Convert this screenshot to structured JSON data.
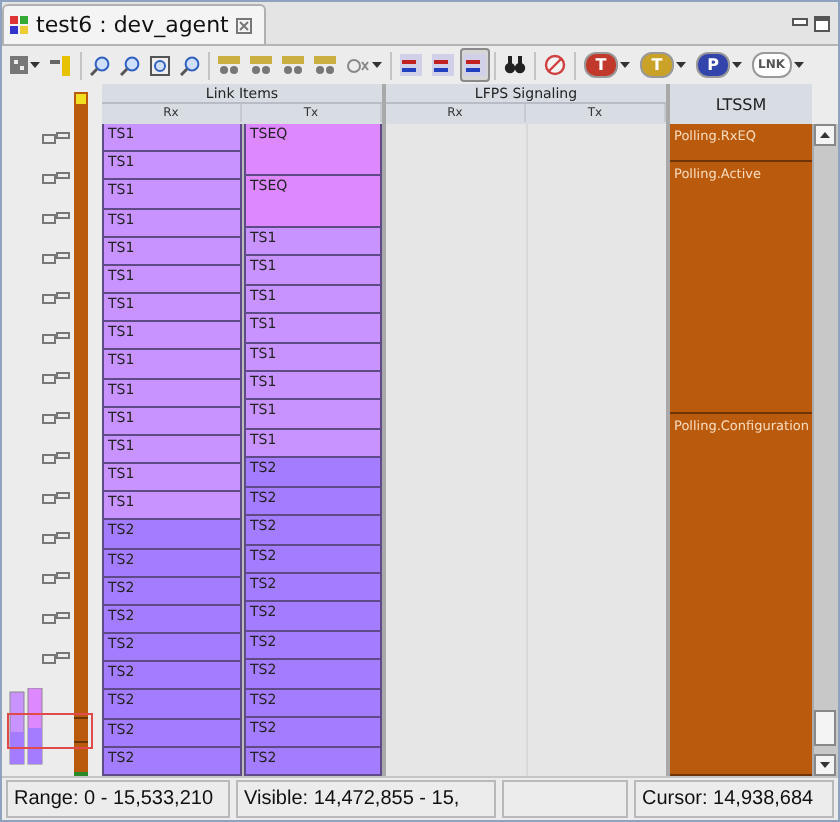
{
  "window": {
    "title": "test6 : dev_agent"
  },
  "toolbar": [
    {
      "kind": "grid",
      "dropdown": true,
      "selected": false
    },
    {
      "kind": "marker",
      "dropdown": false,
      "selected": false
    },
    {
      "kind": "zoom-in",
      "dropdown": false,
      "selected": false
    },
    {
      "kind": "zoom-out",
      "dropdown": false,
      "selected": false
    },
    {
      "kind": "zoom-fit",
      "dropdown": false,
      "selected": false
    },
    {
      "kind": "zoom-person",
      "dropdown": false,
      "selected": false
    },
    {
      "kind": "group",
      "dropdown": false,
      "selected": false
    },
    {
      "kind": "group",
      "dropdown": false,
      "selected": false
    },
    {
      "kind": "group",
      "dropdown": false,
      "selected": false
    },
    {
      "kind": "group",
      "dropdown": false,
      "selected": false
    },
    {
      "kind": "filter",
      "dropdown": true,
      "selected": false
    },
    {
      "kind": "flag",
      "dropdown": false,
      "selected": false
    },
    {
      "kind": "flag",
      "dropdown": false,
      "selected": false
    },
    {
      "kind": "flag",
      "dropdown": false,
      "selected": true
    },
    {
      "kind": "binoculars",
      "dropdown": false,
      "selected": false
    },
    {
      "kind": "cancel",
      "dropdown": false,
      "selected": false
    },
    {
      "kind": "letter",
      "label": "T",
      "color": "#c0392b",
      "dropdown": true,
      "selected": false
    },
    {
      "kind": "letter",
      "label": "T",
      "color": "#c9a227",
      "dropdown": true,
      "selected": false
    },
    {
      "kind": "letter",
      "label": "P",
      "color": "#3344aa",
      "dropdown": true,
      "selected": false
    },
    {
      "kind": "letter",
      "label": "LNK",
      "color": "#ffffff",
      "dropdown": true,
      "selected": false
    }
  ],
  "table": {
    "groups": [
      {
        "title": "Link Items",
        "columns": [
          "Rx",
          "Tx"
        ]
      },
      {
        "title": "LFPS Signaling",
        "columns": [
          "Rx",
          "Tx"
        ]
      }
    ],
    "state_column": "LTSSM",
    "link_rx": [
      {
        "text": "TS1",
        "color": "#c892ff",
        "kind": "short"
      },
      {
        "text": "TS1",
        "color": "#c892ff",
        "kind": "short"
      },
      {
        "text": "TS1",
        "color": "#c892ff",
        "kind": "short"
      },
      {
        "text": "TS1",
        "color": "#c892ff",
        "kind": "short"
      },
      {
        "text": "TS1",
        "color": "#c892ff",
        "kind": "short"
      },
      {
        "text": "TS1",
        "color": "#c892ff",
        "kind": "short"
      },
      {
        "text": "TS1",
        "color": "#c892ff",
        "kind": "short"
      },
      {
        "text": "TS1",
        "color": "#c892ff",
        "kind": "short"
      },
      {
        "text": "TS1",
        "color": "#c892ff",
        "kind": "short"
      },
      {
        "text": "TS1",
        "color": "#c892ff",
        "kind": "short"
      },
      {
        "text": "TS1",
        "color": "#c892ff",
        "kind": "short"
      },
      {
        "text": "TS1",
        "color": "#c892ff",
        "kind": "short"
      },
      {
        "text": "TS1",
        "color": "#c892ff",
        "kind": "short"
      },
      {
        "text": "TS1",
        "color": "#c892ff",
        "kind": "short"
      },
      {
        "text": "TS2",
        "color": "#a47cff",
        "kind": "short"
      },
      {
        "text": "TS2",
        "color": "#a47cff",
        "kind": "short"
      },
      {
        "text": "TS2",
        "color": "#a47cff",
        "kind": "short"
      },
      {
        "text": "TS2",
        "color": "#a47cff",
        "kind": "short"
      },
      {
        "text": "TS2",
        "color": "#a47cff",
        "kind": "short"
      },
      {
        "text": "TS2",
        "color": "#a47cff",
        "kind": "short"
      },
      {
        "text": "TS2",
        "color": "#a47cff",
        "kind": "short"
      },
      {
        "text": "TS2",
        "color": "#a47cff",
        "kind": "short"
      },
      {
        "text": "TS2",
        "color": "#a47cff",
        "kind": "short"
      }
    ],
    "link_tx": [
      {
        "text": "TSEQ",
        "color": "#dd88ff",
        "kind": "long"
      },
      {
        "text": "TSEQ",
        "color": "#dd88ff",
        "kind": "long"
      },
      {
        "text": "TS1",
        "color": "#c892ff",
        "kind": "short"
      },
      {
        "text": "TS1",
        "color": "#c892ff",
        "kind": "short"
      },
      {
        "text": "TS1",
        "color": "#c892ff",
        "kind": "short"
      },
      {
        "text": "TS1",
        "color": "#c892ff",
        "kind": "short"
      },
      {
        "text": "TS1",
        "color": "#c892ff",
        "kind": "short"
      },
      {
        "text": "TS1",
        "color": "#c892ff",
        "kind": "short"
      },
      {
        "text": "TS1",
        "color": "#c892ff",
        "kind": "short"
      },
      {
        "text": "TS1",
        "color": "#c892ff",
        "kind": "short"
      },
      {
        "text": "TS2",
        "color": "#a47cff",
        "kind": "short"
      },
      {
        "text": "TS2",
        "color": "#a47cff",
        "kind": "short"
      },
      {
        "text": "TS2",
        "color": "#a47cff",
        "kind": "short"
      },
      {
        "text": "TS2",
        "color": "#a47cff",
        "kind": "short"
      },
      {
        "text": "TS2",
        "color": "#a47cff",
        "kind": "short"
      },
      {
        "text": "TS2",
        "color": "#a47cff",
        "kind": "short"
      },
      {
        "text": "TS2",
        "color": "#a47cff",
        "kind": "short"
      },
      {
        "text": "TS2",
        "color": "#a47cff",
        "kind": "short"
      },
      {
        "text": "TS2",
        "color": "#a47cff",
        "kind": "short"
      },
      {
        "text": "TS2",
        "color": "#a47cff",
        "kind": "short"
      },
      {
        "text": "TS2",
        "color": "#a47cff",
        "kind": "short"
      }
    ],
    "ltssm": [
      {
        "text": "Polling.RxEQ",
        "kind": "short"
      },
      {
        "text": "Polling.Active",
        "kind": "medium"
      },
      {
        "text": "Polling.Configuration",
        "kind": "rest"
      }
    ]
  },
  "status_bar": {
    "range": "Range: 0 - 15,533,210",
    "visible": "Visible: 14,472,855 - 15,",
    "cursor": "Cursor: 14,938,684"
  }
}
